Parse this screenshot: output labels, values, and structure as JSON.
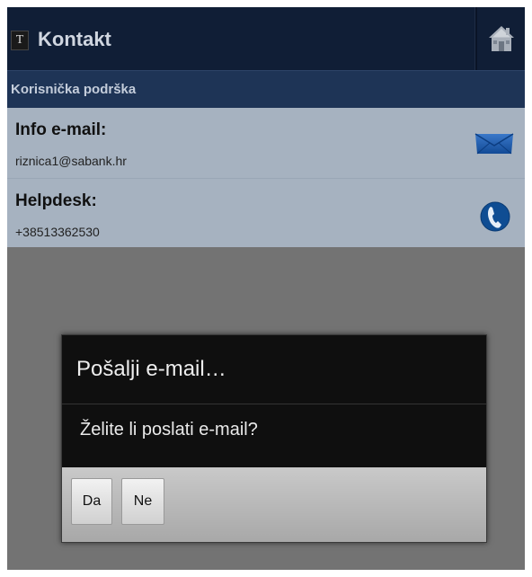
{
  "actionbar": {
    "app_icon_letter": "T",
    "title": "Kontakt",
    "home_icon": "home-icon"
  },
  "section": {
    "label": "Korisnička podrška"
  },
  "contacts": [
    {
      "label": "Info e-mail:",
      "value": "riznica1@sabank.hr",
      "icon": "envelope-icon"
    },
    {
      "label": "Helpdesk:",
      "value": "+38513362530",
      "icon": "phone-icon"
    }
  ],
  "dialog": {
    "title": "Pošalji e-mail…",
    "message": "Želite li poslati e-mail?",
    "confirm_label": "Da",
    "cancel_label": "Ne"
  },
  "colors": {
    "actionbar": "#101e36",
    "section_header": "#1e3456",
    "row_background": "#a6b2c0",
    "overlay": "#737373",
    "dialog_background": "#0f0f0f"
  }
}
